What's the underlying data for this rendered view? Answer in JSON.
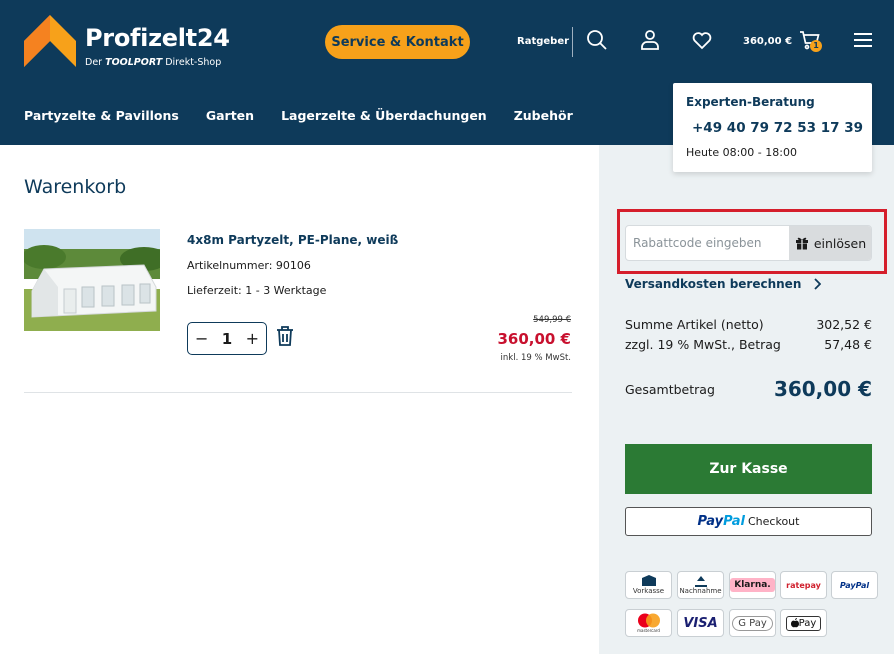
{
  "header": {
    "logo_name": "Profizelt24",
    "logo_sub_prefix": "Der ",
    "logo_sub_brand": "TOOLPORT",
    "logo_sub_suffix": " Direkt-Shop",
    "service_button": "Service & Kontakt",
    "ratgeber": "Ratgeber",
    "cart_total": "360,00 €",
    "cart_count": "1",
    "icons": [
      "search-icon",
      "user-icon",
      "heart-icon",
      "cart-icon",
      "menu-icon"
    ],
    "colors": {
      "background": "#0e3a5a",
      "accent": "#f7a11a"
    }
  },
  "nav": {
    "items": [
      "Partyzelte & Pavillons",
      "Garten",
      "Lagerzelte & Überdachungen",
      "Zubehör"
    ]
  },
  "expert": {
    "title": "Experten-Beratung",
    "phone": "+49 40 79 72 53 17 39",
    "hours": "Heute 08:00 - 18:00"
  },
  "cart": {
    "title": "Warenkorb",
    "item": {
      "name": "4x8m Partyzelt, PE-Plane, weiß",
      "article_number": "Artikelnummer: 90106",
      "delivery": "Lieferzeit: 1 - 3 Werktage",
      "quantity": "1",
      "old_price": "549,99 €",
      "price": "360,00 €",
      "tax_note": "inkl. 19 % MwSt."
    }
  },
  "summary": {
    "coupon_placeholder": "Rabattcode eingeben",
    "coupon_button": "einlösen",
    "shipping_link": "Versandkosten berechnen",
    "net_label": "Summe Artikel (netto)",
    "net_value": "302,52 €",
    "vat_label": "zzgl. 19 % MwSt., Betrag",
    "vat_value": "57,48 €",
    "total_label": "Gesamtbetrag",
    "total_value": "360,00 €",
    "checkout_button": "Zur Kasse",
    "paypal_pay": "Pay",
    "paypal_pal": "Pal",
    "paypal_checkout": "Checkout",
    "colors": {
      "checkout": "#2b7a34",
      "price": "#c8102e",
      "highlight": "#d51e2b"
    }
  },
  "payment_methods": {
    "vorkasse": "Vorkasse",
    "nachnahme": "Nachnahme",
    "klarna": "Klarna.",
    "ratepay": "ratepay",
    "paypal": "PayPal",
    "mastercard": "mastercard",
    "visa": "VISA",
    "gpay": "G Pay",
    "applepay": "Pay"
  }
}
